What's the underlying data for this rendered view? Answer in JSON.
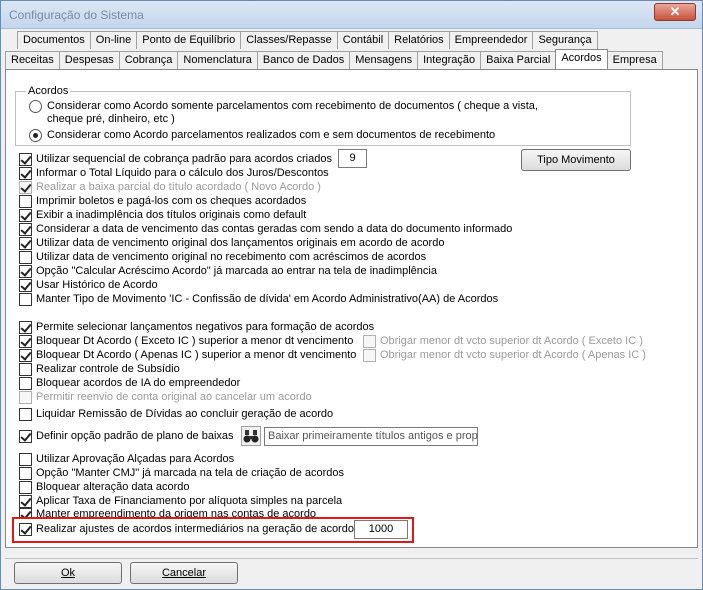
{
  "window": {
    "title": "Configuração do Sistema",
    "close_glyph": "✕"
  },
  "tabs_row1": [
    "Documentos",
    "On-line",
    "Ponto de Equilíbrio",
    "Classes/Repasse",
    "Contábil",
    "Relatórios",
    "Empreendedor",
    "Segurança"
  ],
  "tabs_row2": [
    "Receitas",
    "Despesas",
    "Cobrança",
    "Nomenclatura",
    "Banco de Dados",
    "Mensagens",
    "Integração",
    "Baixa Parcial",
    "Acordos",
    "Empresa"
  ],
  "active_tab": "Acordos",
  "acordos_group": {
    "label": "Acordos",
    "radio1_line1": "Considerar como Acordo somente parcelamentos com recebimento de documentos ( cheque a vista,",
    "radio1_line2": "cheque pré, dinheiro, etc )",
    "radio2": "Considerar como Acordo parcelamentos realizados com e sem documentos de recebimento"
  },
  "options": {
    "seq_cobranca": "Utilizar sequencial de cobrança padrão para acordos criados",
    "seq_value": "9",
    "tipo_movimento_button": "Tipo Movimento",
    "total_liquido": "Informar o Total Líquido para o cálculo dos Juros/Descontos",
    "baixa_parcial": "Realizar a baixa parcial do título acordado ( Novo Acordo )",
    "imprimir_boletos": "Imprimir boletos e pagá-los com os cheques acordados",
    "exibir_inadimplencia": "Exibir a inadimplência dos títulos originais como default",
    "data_vencimento_contas": "Considerar a data de vencimento das contas geradas com sendo a data do documento informado",
    "data_vencimento_original": "Utilizar data de vencimento original dos lançamentos originais em acordo de acordo",
    "data_vencimento_recebimento": "Utilizar data de vencimento original no recebimento com acréscimos de acordos",
    "calcular_acrescimo": "Opção \"Calcular Acréscimo Acordo\" já marcada ao entrar na tela de inadimplência",
    "usar_historico": "Usar Histórico de Acordo",
    "manter_tipo_movimento": "Manter Tipo de Movimento 'IC - Confissão de dívida' em Acordo Administrativo(AA) de Acordos",
    "lancamentos_negativos": "Permite selecionar lançamentos negativos para formação de acordos",
    "bloquear_exceto_ic": "Bloquear Dt Acordo ( Exceto IC ) superior a menor dt vencimento",
    "bloquear_apenas_ic": "Bloquear Dt Acordo ( Apenas IC ) superior a menor dt vencimento",
    "obrigar_exceto_ic": "Obrigar menor dt vcto superior dt Acordo ( Exceto IC )",
    "obrigar_apenas_ic": "Obrigar menor dt vcto superior dt Acordo ( Apenas IC )",
    "controle_subsidio": "Realizar controle de Subsídio",
    "bloquear_ia": "Bloquear acordos de IA do empreendedor",
    "permitir_reenvio": "Permitir reenvio de conta original ao cancelar um acordo",
    "liquidar_remissao": "Liquidar Remissão de Dívidas ao concluir geração de acordo",
    "plano_baixas": "Definir opção padrão de plano de baixas",
    "plano_baixas_value": "Baixar primeiramente títulos antigos e propor",
    "aprovacao_alcadas": "Utilizar Aprovação Alçadas para Acordos",
    "manter_cmj": "Opção \"Manter CMJ\" já marcada na tela de criação de acordos",
    "bloquear_alteracao": "Bloquear alteração data acordo",
    "taxa_financiamento": "Aplicar Taxa de Financiamento por alíquota simples na parcela",
    "manter_empreendimento": "Manter empreendimento da origem nas contas de acordo",
    "ajustes_intermediarios": "Realizar ajustes de acordos intermediários na geração de acordo.",
    "ajustes_value": "1000"
  },
  "buttons": {
    "ok": "Ok",
    "cancelar": "Cancelar"
  },
  "colors": {
    "highlight": "#e01818",
    "disabled_text": "#9a9a9a"
  }
}
